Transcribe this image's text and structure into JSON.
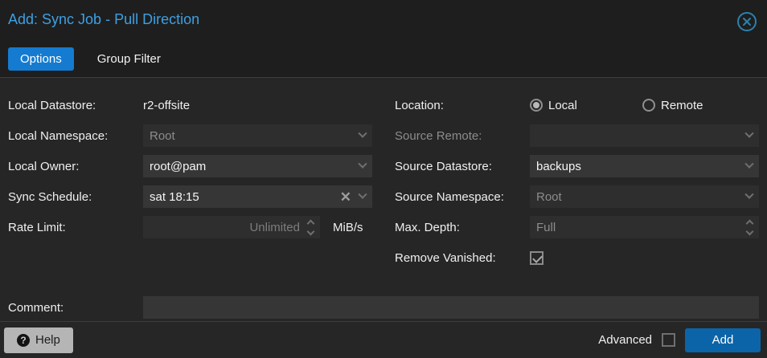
{
  "dialog": {
    "title": "Add: Sync Job - Pull Direction"
  },
  "tabs": [
    {
      "label": "Options",
      "active": true
    },
    {
      "label": "Group Filter",
      "active": false
    }
  ],
  "form": {
    "left": {
      "local_datastore": {
        "label": "Local Datastore:",
        "value": "r2-offsite"
      },
      "local_namespace": {
        "label": "Local Namespace:",
        "value": "Root",
        "disabled": true
      },
      "local_owner": {
        "label": "Local Owner:",
        "value": "root@pam"
      },
      "sync_schedule": {
        "label": "Sync Schedule:",
        "value": "sat 18:15"
      },
      "rate_limit": {
        "label": "Rate Limit:",
        "value": "",
        "placeholder": "Unlimited",
        "unit": "MiB/s"
      }
    },
    "right": {
      "location": {
        "label": "Location:",
        "options": [
          {
            "label": "Local",
            "selected": true
          },
          {
            "label": "Remote",
            "selected": false
          }
        ]
      },
      "source_remote": {
        "label": "Source Remote:",
        "value": "",
        "disabled": true
      },
      "source_datastore": {
        "label": "Source Datastore:",
        "value": "backups"
      },
      "source_namespace": {
        "label": "Source Namespace:",
        "value": "Root",
        "disabled": true
      },
      "max_depth": {
        "label": "Max. Depth:",
        "value": "Full",
        "disabled": true
      },
      "remove_vanished": {
        "label": "Remove Vanished:",
        "checked": true
      }
    },
    "comment": {
      "label": "Comment:",
      "value": "",
      "placeholder": ""
    }
  },
  "footer": {
    "help_label": "Help",
    "help_icon_glyph": "?",
    "advanced_label": "Advanced",
    "advanced_checked": false,
    "add_label": "Add"
  },
  "icons": {
    "close": "circle-x",
    "combo": "chevron-down",
    "clear": "x",
    "spinner": "up-down-chevrons"
  },
  "colors": {
    "title_blue": "#3da0e3",
    "tab_active_bg": "#147bd1",
    "add_button_bg": "#0c64a8",
    "close_icon": "#2c82ad",
    "window_bg": "#262626",
    "header_bg": "#1e1e1e",
    "field_bg": "#363636",
    "field_disabled_bg": "#2e2e2e",
    "disabled_text": "#8c8c8c",
    "separator": "#3d3d3d"
  }
}
